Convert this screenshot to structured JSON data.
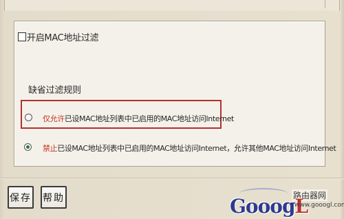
{
  "filter_toggle": {
    "label": "开启MAC地址过滤",
    "checked": false
  },
  "default_rule": {
    "section_label": "缺省过滤规则",
    "options": [
      {
        "highlight": "仅允许",
        "text": "已设MAC地址列表中已启用的MAC地址访问Internet",
        "selected": false
      },
      {
        "highlight": "禁止",
        "text": "已设MAC地址列表中已启用的MAC地址访问Internet，允许其他MAC地址访问Internet",
        "selected": true
      }
    ]
  },
  "buttons": {
    "save_label": "保存",
    "help_label": "帮助"
  },
  "watermark": {
    "brand_main": "Gooog",
    "brand_accent": "L",
    "site_name": "路由器网",
    "site_url": "www.gooogl.com"
  },
  "colors": {
    "highlight_red": "#c43a22",
    "rule_box_border": "#b2302c",
    "radio_selected": "#2a7a3a",
    "brand_blue": "#2d3a8c"
  }
}
